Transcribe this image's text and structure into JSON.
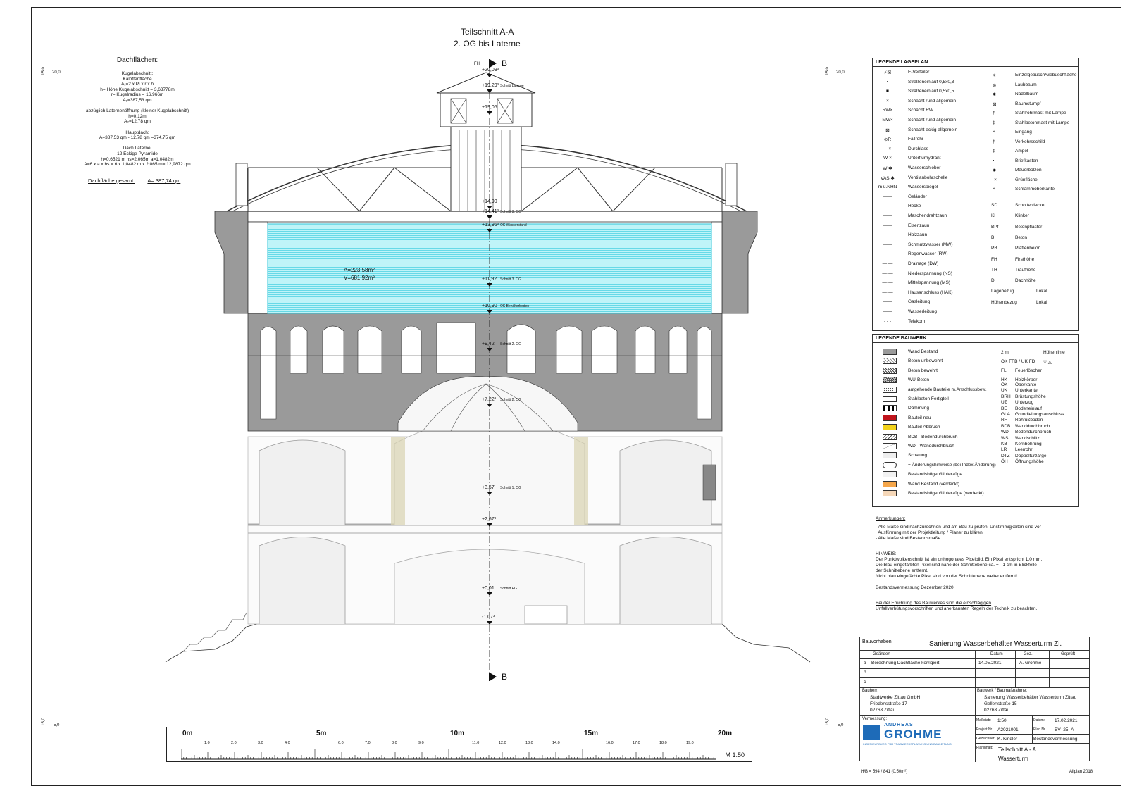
{
  "title": {
    "line1": "Teilschnitt A-A",
    "line2": "2. OG bis Laterne"
  },
  "section_marker": "B",
  "height_marks_left": [
    "20,0",
    "-5,0"
  ],
  "height_marks_right": [
    "20,0",
    "-5,0"
  ],
  "side_marks_left": [
    "15,0",
    "15,0"
  ],
  "side_marks_right": [
    "15,0",
    "15,0"
  ],
  "roof_calc": {
    "heading": "Dachflächen:",
    "lines": [
      "Kugelabschnitt:",
      "Kalottenfläche",
      "A₁=2 x Pi x r x h",
      "h= Höhe Kugelabschnitt = 3,63778m",
      "r= Kugelradius = 16,966m",
      "A₁=387,53 qm",
      "",
      "abzüglich Laternenöffnung (kleiner Kugelabschnitt)",
      "h=0,12m",
      "A₂=12,78 qm",
      "",
      "Hauptdach:",
      "A=387,53 qm - 12,78 qm =374,75 qm",
      "",
      "Dach Laterne:",
      "12 Eckige Pyramide",
      "h=0,6521 m hs=2,065m a=1,0482m",
      "A=6 x a x hs = 6 x 1,0482 m x 2,065 m= 12,9872 qm"
    ],
    "total_label": "Dachfläche gesamt:",
    "total_value": "A= 387,74 qm"
  },
  "drawing_labels": {
    "fh": "FH",
    "levels": [
      {
        "value": "+20,09³",
        "note": ""
      },
      {
        "value": "+19,29³",
        "note": "Schnitt Laterne"
      },
      {
        "value": "+19,05",
        "note": ""
      },
      {
        "value": "+14,90",
        "note": ""
      },
      {
        "value": "+14,41³",
        "note": "Schnitt 3. OG"
      },
      {
        "value": "+13,96³",
        "note": "OK Wasserstand"
      },
      {
        "value": "+11,92",
        "note": "Schnitt 3. OG"
      },
      {
        "value": "+10,90",
        "note": "OK Behälterboden"
      },
      {
        "value": "+9,42",
        "note": "Schnitt 2. OG"
      },
      {
        "value": "+7,22³",
        "note": "Schnitt 2. OG"
      },
      {
        "value": "+3,57",
        "note": "Schnitt 1. OG"
      },
      {
        "value": "+2,67³",
        "note": ""
      },
      {
        "value": "+0,01",
        "note": "Schnitt EG"
      },
      {
        "value": "-1,07³",
        "note": ""
      }
    ],
    "tank_area": "A=223,58m²",
    "tank_volume": "V=681,92m³"
  },
  "scale_bar": {
    "major_labels": [
      "0m",
      "5m",
      "10m",
      "15m",
      "20m"
    ],
    "minor_labels": [
      "1,0",
      "2,0",
      "3,0",
      "4,0",
      "6,0",
      "7,0",
      "8,0",
      "9,0",
      "11,0",
      "12,0",
      "13,0",
      "14,0",
      "16,0",
      "17,0",
      "18,0",
      "19,0"
    ],
    "scale_text": "M 1:50"
  },
  "legend_site": {
    "title": "LEGENDE LAGEPLAN:",
    "left": [
      {
        "sym": "⚡☒",
        "label": "E-Verteiler"
      },
      {
        "sym": "▪",
        "label": "Straßeneinlauf 0,5x0,3"
      },
      {
        "sym": "■",
        "label": "Straßeneinlauf 0,5x0,5"
      },
      {
        "sym": "×",
        "label": "Schacht rund allgemein"
      },
      {
        "sym": "RW×",
        "label": "Schacht RW"
      },
      {
        "sym": "MW×",
        "label": "Schacht rund allgemein"
      },
      {
        "sym": "⊠",
        "label": "Schacht eckig allgemein"
      },
      {
        "sym": "⊘R",
        "label": "Fallrohr"
      },
      {
        "sym": "—×",
        "label": "Durchlass"
      },
      {
        "sym": "W ×",
        "label": "Unterflurhydrant"
      },
      {
        "sym": "W ✱",
        "label": "Wasserschieber"
      },
      {
        "sym": "VAS ✱",
        "label": "Ventilanbohrschelle"
      },
      {
        "sym": "m ü.NHN",
        "label": "Wasserspiegel"
      },
      {
        "sym": "——",
        "label": "Geländer"
      },
      {
        "sym": "····",
        "label": "Hecke"
      },
      {
        "sym": "——",
        "label": "Maschendrahtzaun"
      },
      {
        "sym": "——",
        "label": "Eisenzaun"
      },
      {
        "sym": "——",
        "label": "Holzzaun"
      },
      {
        "sym": "——",
        "label": "Schmutzwasser (MW)"
      },
      {
        "sym": "— —",
        "label": "Regenwasser (RW)"
      },
      {
        "sym": "— —",
        "label": "Drainage (DW)"
      },
      {
        "sym": "—·—",
        "label": "Niederspannung (NS)"
      },
      {
        "sym": "—·—",
        "label": "Mittelspannung (MS)"
      },
      {
        "sym": "—·—",
        "label": "Hausanschluss (HAK)"
      },
      {
        "sym": "——",
        "label": "Gasleitung"
      },
      {
        "sym": "——",
        "label": "Wasserleitung"
      },
      {
        "sym": "- - -",
        "label": "Telekom"
      }
    ],
    "right": [
      {
        "sym": "✴",
        "label": "Einzelgebüsch/Gebüschfläche"
      },
      {
        "sym": "⊗",
        "label": "Laubbaum"
      },
      {
        "sym": "✸",
        "label": "Nadelbaum"
      },
      {
        "sym": "⊠",
        "label": "Baumstumpf"
      },
      {
        "sym": "†",
        "label": "Stahlrohrmast mit Lampe"
      },
      {
        "sym": "‡",
        "label": "Stahlbetonmast mit Lampe"
      },
      {
        "sym": "×",
        "label": "Eingang"
      },
      {
        "sym": "†",
        "label": "Verkehrsschild"
      },
      {
        "sym": "‡",
        "label": "Ampel"
      },
      {
        "sym": "▪",
        "label": "Briefkasten"
      },
      {
        "sym": "✹",
        "label": "Mauerbolzen"
      },
      {
        "sym": "·×·",
        "label": "Grünfläche"
      },
      {
        "sym": "×",
        "label": "Schlammoberkante"
      },
      {
        "sym": "SD",
        "label": "Schotterdecke"
      },
      {
        "sym": "Kl",
        "label": "Klinker"
      },
      {
        "sym": "BPf",
        "label": "Betonpflaster"
      },
      {
        "sym": "B",
        "label": "Beton"
      },
      {
        "sym": "PB",
        "label": "Plattenbelon"
      },
      {
        "sym": "FH",
        "label": "Firsthöhe"
      },
      {
        "sym": "TH",
        "label": "Traufhöhe"
      },
      {
        "sym": "DH",
        "label": "Dachhöhe"
      },
      {
        "sym": "Lagebezug",
        "label": "Lokal"
      },
      {
        "sym": "Höhenbezug",
        "label": "Lokal"
      }
    ]
  },
  "legend_building": {
    "title": "LEGENDE BAUWERK:",
    "left": [
      {
        "swatch": "#9a9a9a",
        "label": "Wand Bestand"
      },
      {
        "swatch": "hatch1",
        "label": "Beton unbewehrt"
      },
      {
        "swatch": "hatch2",
        "label": "Beton bewehrt"
      },
      {
        "swatch": "hatch3",
        "label": "WU-Beton"
      },
      {
        "swatch": "dots",
        "label": "aufgehende Bauteile m.Anschlussbew."
      },
      {
        "swatch": "grid",
        "label": "Stahlbeton Fertigteil"
      },
      {
        "swatch": "check",
        "label": "Dämmung"
      },
      {
        "swatch": "#c0141c",
        "label": "Bauteil neu"
      },
      {
        "swatch": "#f2d21a",
        "label": "Bauteil Abbruch"
      },
      {
        "swatch": "hatch4",
        "label": "BDB - Bodendurchbruch"
      },
      {
        "swatch": "cross",
        "label": "WD - Wanddurchbruch"
      },
      {
        "swatch": "#eeeeee",
        "label": "Schalung"
      },
      {
        "swatch": "cloud",
        "label": "= Änderungshinweise (bei Index Änderung)"
      },
      {
        "swatch": "#f2f2f2",
        "label": "Bestandsbögen/Unterzüge"
      },
      {
        "swatch": "#f5a64a",
        "label": "Wand Bestand (verdeckt)"
      },
      {
        "swatch": "#f5d7b8",
        "label": "Bestandsbögen/Unterzüge (verdeckt)"
      }
    ],
    "right": [
      {
        "sym": "2 m",
        "label": "Höhenlinie"
      },
      {
        "sym": "OK FFB / UK FD",
        "label": "▽ △"
      },
      {
        "sym": "FL",
        "label": "Feuerlöscher"
      },
      {
        "sym": "HK",
        "label": "Heizkörper"
      },
      {
        "sym": "OK",
        "label": "Oberkante"
      },
      {
        "sym": "UK",
        "label": "Unterkante"
      },
      {
        "sym": "BRH",
        "label": "Brüstungshöhe"
      },
      {
        "sym": "UZ",
        "label": "Unterzug"
      },
      {
        "sym": "BE",
        "label": "Bodeneinlauf"
      },
      {
        "sym": "GLA",
        "label": "Grundleitungsanschluss"
      },
      {
        "sym": "RF",
        "label": "Rohfußboden"
      },
      {
        "sym": "BDB",
        "label": "Wanddurchbruch"
      },
      {
        "sym": "WD",
        "label": "Bodendurchbruch"
      },
      {
        "sym": "WS",
        "label": "Wandschlitz"
      },
      {
        "sym": "KB",
        "label": "Kernbohrung"
      },
      {
        "sym": "LR",
        "label": "Leerrohr"
      },
      {
        "sym": "DTZ",
        "label": "Doppeltürzarge"
      },
      {
        "sym": "ÖH",
        "label": "Öffnungshöhe"
      }
    ]
  },
  "notes": {
    "heading": "Anmerkungen:",
    "lines": [
      "- Alle Maße sind nachzurechnen und am Bau zu prüfen. Unstimmigkeiten sind vor",
      "  Ausführung mit der Projektleitung / Planer zu klären.",
      "- Alle Maße sind Bestandsmaße."
    ],
    "hint_heading": "HINWEIS:",
    "hint_lines": [
      "Der Punktwolkenschnitt ist ein orthogonales Pixelbild. Ein Pixel entspricht 1,0 mm.",
      "Die blau eingefärbten Pixel sind nahe der Schnittebene ca. + - 1 cm in Blickfelle",
      "der Schnittebene entfernt.",
      "Nicht blau eingefärbte Pixel sind von der Schnittebene weiter entfernt!"
    ],
    "survey": "Bestandsvermessung Dezember 2020",
    "safety_lines": [
      "Bei der Errichtung des Bauwerkes sind die einschlägigen",
      "Unfallverhütungsvorschriften und anerkannten Regeln der Technik zu beachten."
    ]
  },
  "title_block": {
    "project_label": "Bauvorhaben:",
    "project": "Sanierung Wasserbehälter Wasserturm Zi.",
    "headers": [
      "Geändert",
      "Datum",
      "Gez.",
      "Geprüft"
    ],
    "revisions": [
      {
        "index": "a",
        "text": "Berechnung Dachfläche korrigiert",
        "date": "14.05.2021",
        "by": "A. Grohme"
      },
      {
        "index": "b",
        "text": "",
        "date": "",
        "by": ""
      },
      {
        "index": "c",
        "text": "",
        "date": "",
        "by": ""
      }
    ],
    "owner_label": "Bauherr:",
    "owner_lines": [
      "Stadtwerke Zittau GmbH",
      "Friedensstraße 17",
      "02763 Zittau"
    ],
    "measure_label": "Bauwerk / Baumaßnahme:",
    "measure_lines": [
      "Sanierung Wasserbehälter Wasserturm Zittau",
      "Gellertstraße 15",
      "02763 Zittau"
    ],
    "surveyor_label": "Vermessung:",
    "company_top": "ANDREAS",
    "company_name": "GROHME",
    "company_sub": "INGENIEURBÜRO FÜR TRAGWERKSPLANUNG UND BAULEITUNG",
    "fields": [
      {
        "label": "Maßstab:",
        "value": "1:50"
      },
      {
        "label": "Datum:",
        "value": "17.02.2021"
      },
      {
        "label": "Projekt Nr.",
        "value": "A2021001"
      },
      {
        "label": "Plan Nr.",
        "value": "BV_25_A"
      },
      {
        "label": "Gezeichnet:",
        "value": "K. Kindler"
      },
      {
        "label": "",
        "value": "Bestandsvermessung"
      },
      {
        "label": "Planinhalt:",
        "value": "Teilschnitt A - A"
      },
      {
        "label": "",
        "value": "Wasserturm"
      }
    ],
    "format": "H/B = 594 / 841 (0.50m²)",
    "software": "Allplan 2018"
  },
  "colors": {
    "wall": "#9a9a9a",
    "water": "#5ee0ee",
    "line": "#111111"
  }
}
